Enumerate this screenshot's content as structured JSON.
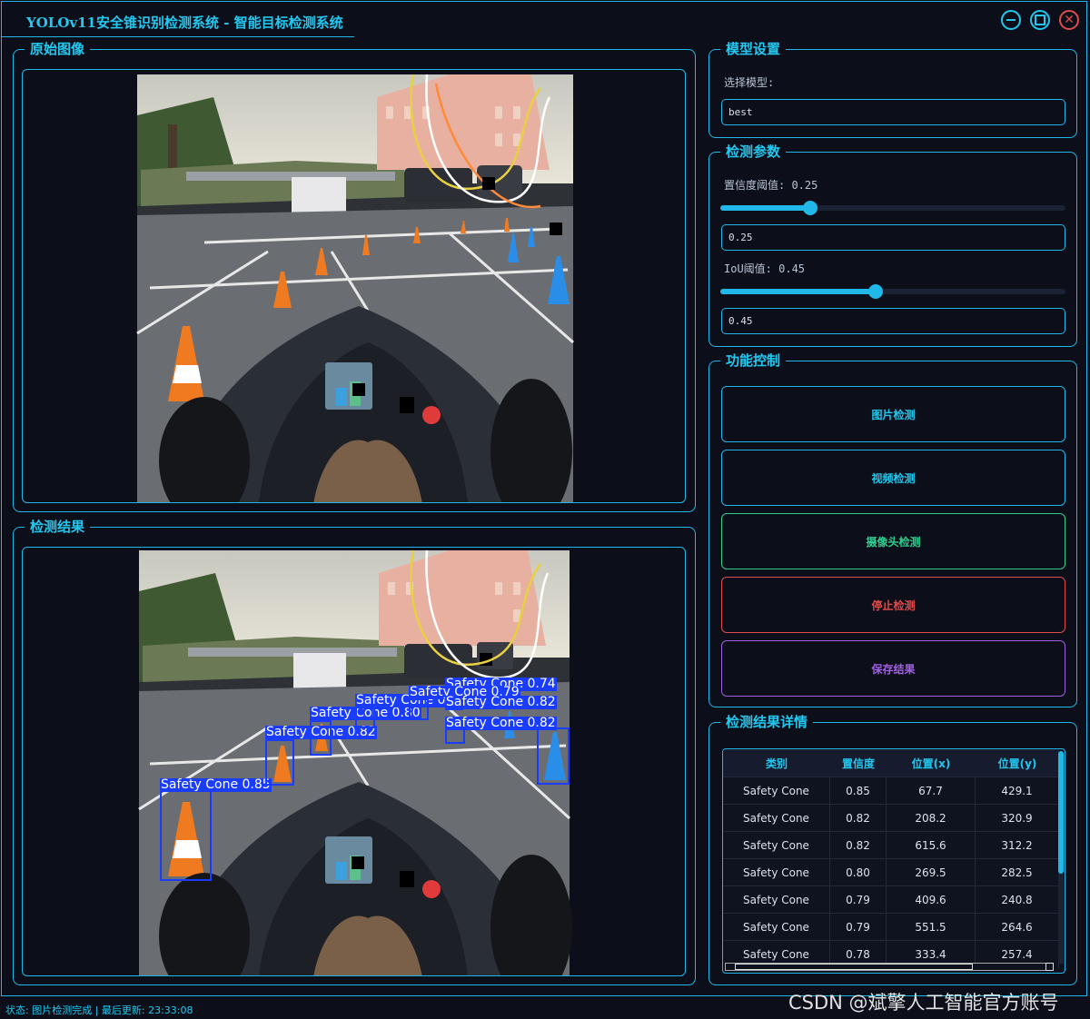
{
  "window": {
    "title": "YOLOv11安全锥识别检测系统 - 智能目标检测系统",
    "minimize_icon": "minimize-icon",
    "maximize_icon": "maximize-icon",
    "close_icon": "close-icon",
    "close_glyph": "✕"
  },
  "original_panel": {
    "title": "原始图像"
  },
  "result_panel": {
    "title": "检测结果",
    "detections": [
      {
        "label": "Safety Cone 0.85"
      },
      {
        "label": "Safety Cone 0.82"
      },
      {
        "label": "Safety Cone 0.80"
      },
      {
        "label": "Safety Cone 0.79"
      },
      {
        "label": "Safety Cone 0.74"
      },
      {
        "label": "Safety Cone 0.79"
      },
      {
        "label": "Safety Cone 0.82"
      }
    ]
  },
  "model": {
    "title": "模型设置",
    "select_label": "选择模型:",
    "selected": "best"
  },
  "params": {
    "title": "检测参数",
    "conf_label": "置信度阈值: 0.25",
    "conf_value": "0.25",
    "conf_fraction": 0.26,
    "iou_label": "IoU阈值: 0.45",
    "iou_value": "0.45",
    "iou_fraction": 0.45
  },
  "controls": {
    "title": "功能控制",
    "image_btn": "图片检测",
    "video_btn": "视频检测",
    "camera_btn": "摄像头检测",
    "stop_btn": "停止检测",
    "save_btn": "保存结果"
  },
  "details": {
    "title": "检测结果详情",
    "headers": [
      "类别",
      "置信度",
      "位置(x)",
      "位置(y)"
    ],
    "rows": [
      [
        "Safety Cone",
        "0.85",
        "67.7",
        "429.1"
      ],
      [
        "Safety Cone",
        "0.82",
        "208.2",
        "320.9"
      ],
      [
        "Safety Cone",
        "0.82",
        "615.6",
        "312.2"
      ],
      [
        "Safety Cone",
        "0.80",
        "269.5",
        "282.5"
      ],
      [
        "Safety Cone",
        "0.79",
        "409.6",
        "240.8"
      ],
      [
        "Safety Cone",
        "0.79",
        "551.5",
        "264.6"
      ],
      [
        "Safety Cone",
        "0.78",
        "333.4",
        "257.4"
      ]
    ]
  },
  "status": {
    "text": "状态: 图片检测完成 | 最后更新: 23:33:08"
  },
  "watermark": {
    "text": "CSDN @斌擎人工智能官方账号"
  },
  "colors": {
    "accent": "#1fb8e8",
    "background": "#0c0f1a",
    "detection_box": "#1a3cff",
    "camera": "#2fcf8f",
    "stop": "#e04b4b",
    "save": "#a060e0"
  }
}
